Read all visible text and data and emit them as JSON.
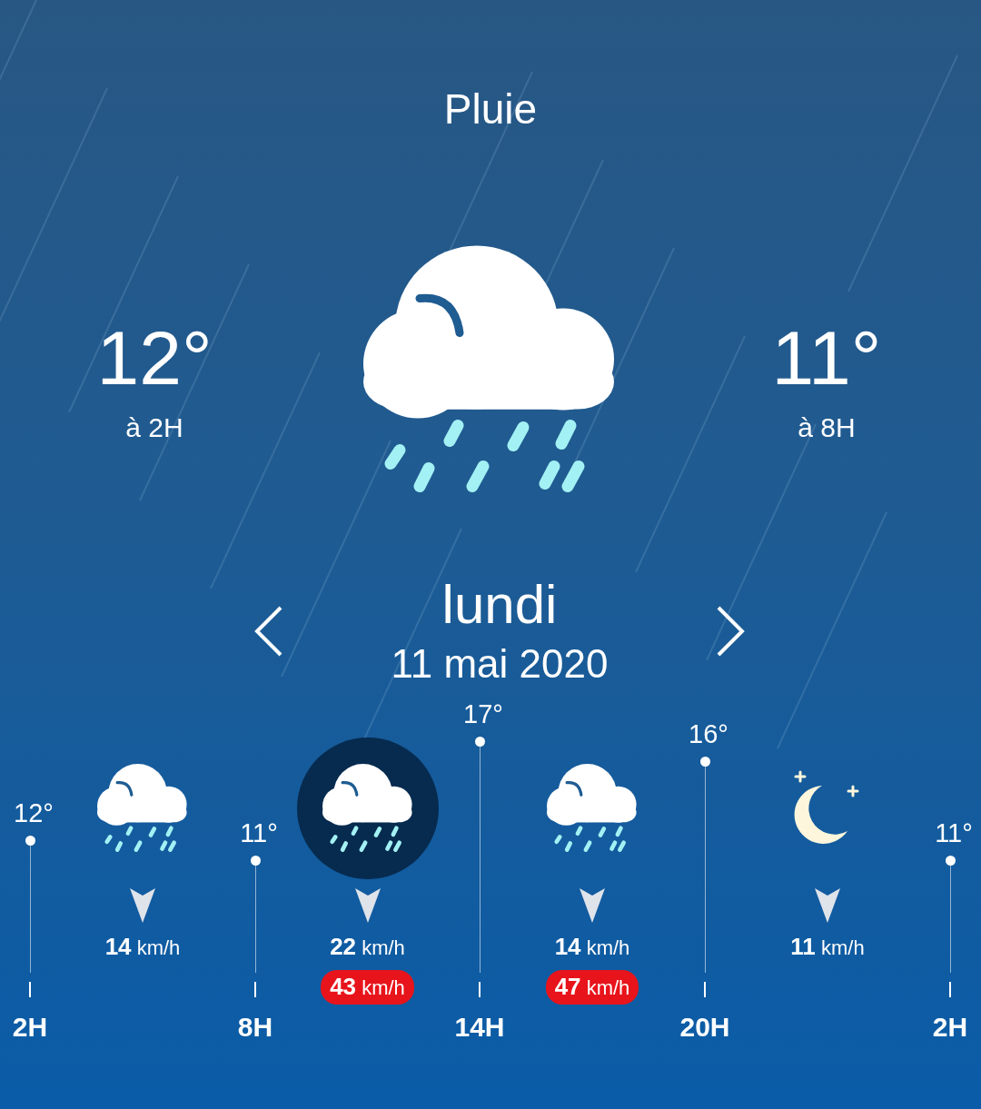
{
  "condition": "Pluie",
  "extremes": [
    {
      "temp": "12°",
      "time": "à 2H"
    },
    {
      "temp": "11°",
      "time": "à 8H"
    }
  ],
  "weather_icon": {
    "kind": "rain"
  },
  "day": {
    "name": "lundi",
    "date": "11 mai 2020"
  },
  "hourly": {
    "points": [
      {
        "temp": "12°",
        "hour": "2H"
      },
      {
        "temp": "11°",
        "hour": "8H"
      },
      {
        "temp": "17°",
        "hour": "14H"
      },
      {
        "temp": "16°",
        "hour": "20H"
      },
      {
        "temp": "11°",
        "hour": "2H"
      }
    ],
    "intervals": [
      {
        "kind": "rain",
        "selected": false,
        "wind": "**14** km/h"
      },
      {
        "kind": "rain",
        "selected": true,
        "wind": "**22** km/h",
        "gust": "**43** km/h"
      },
      {
        "kind": "rain",
        "selected": false,
        "wind": "**14** km/h",
        "gust": "**47** km/h"
      },
      {
        "kind": "night",
        "selected": false,
        "wind": "**11** km/h"
      }
    ]
  }
}
